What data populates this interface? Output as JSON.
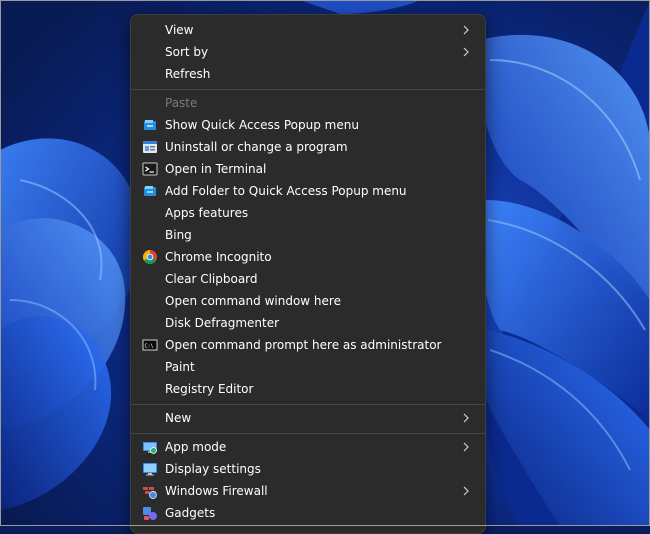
{
  "menu": {
    "group1": [
      {
        "label": "View",
        "submenu": true
      },
      {
        "label": "Sort by",
        "submenu": true
      },
      {
        "label": "Refresh",
        "submenu": false
      }
    ],
    "group2": [
      {
        "label": "Paste",
        "icon": "",
        "disabled": true
      },
      {
        "label": "Show Quick Access Popup menu",
        "icon": "quick-access-icon"
      },
      {
        "label": "Uninstall or change a program",
        "icon": "programs-icon"
      },
      {
        "label": "Open in Terminal",
        "icon": "terminal-icon"
      },
      {
        "label": "Add Folder to Quick Access Popup menu",
        "icon": "quick-access-icon"
      },
      {
        "label": "Apps  features",
        "icon": ""
      },
      {
        "label": "Bing",
        "icon": ""
      },
      {
        "label": "Chrome Incognito",
        "icon": "chrome-icon"
      },
      {
        "label": "Clear Clipboard",
        "icon": ""
      },
      {
        "label": "Open command window here",
        "icon": ""
      },
      {
        "label": "Disk Defragmenter",
        "icon": ""
      },
      {
        "label": "Open command prompt here as administrator",
        "icon": "command-prompt-icon"
      },
      {
        "label": "Paint",
        "icon": ""
      },
      {
        "label": "Registry Editor",
        "icon": ""
      }
    ],
    "group3": [
      {
        "label": "New",
        "submenu": true
      }
    ],
    "group4": [
      {
        "label": "App mode",
        "icon": "app-mode-icon",
        "submenu": true
      },
      {
        "label": "Display settings",
        "icon": "display-icon",
        "submenu": false
      },
      {
        "label": "Windows Firewall",
        "icon": "firewall-icon",
        "submenu": true
      },
      {
        "label": "Gadgets",
        "icon": "gadgets-icon",
        "submenu": false
      }
    ]
  },
  "colors": {
    "menu_bg": "#2b2b2b",
    "text": "#ffffff",
    "disabled_text": "#7a7a7a",
    "separator": "#454545",
    "wallpaper_deep": "#0a1e5c",
    "wallpaper_bright": "#2f6bff"
  }
}
